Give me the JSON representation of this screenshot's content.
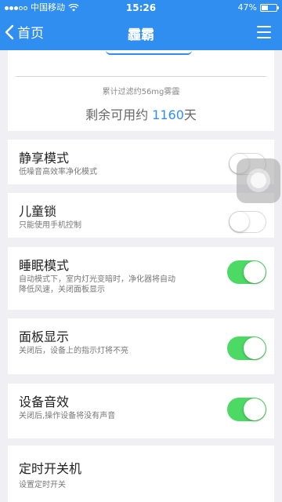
{
  "status_bar": {
    "carrier": "中国移动",
    "time": "15:26",
    "battery": "47%",
    "battery_level": 0.47
  },
  "nav": {
    "back_label": "首页",
    "title": "霾霸",
    "menu_icon": "hamburger-menu-icon"
  },
  "filter": {
    "accumulated": "累计过滤约56mg雾霾",
    "remaining_prefix": "剩余可用约 ",
    "remaining_days": "1160",
    "remaining_suffix": "天"
  },
  "settings": [
    {
      "title": "静享模式",
      "desc": "低噪音高效率净化模式",
      "enabled": false
    },
    {
      "title": "儿童锁",
      "desc": "只能使用手机控制",
      "enabled": false
    },
    {
      "title": "睡眠模式",
      "desc": "自动模式下，室内灯光变暗时，净化器将自动降低风速，关闭面板显示",
      "enabled": true
    },
    {
      "title": "面板显示",
      "desc": "关闭后，设备上的指示灯将不亮",
      "enabled": true
    },
    {
      "title": "设备音效",
      "desc": "关闭后,操作设备将没有声音",
      "enabled": true
    },
    {
      "title": "定时开关机",
      "desc": "设置定时开关"
    }
  ],
  "colors": {
    "accent": "#2f8ef0",
    "toggle_on": "#4cd964"
  }
}
